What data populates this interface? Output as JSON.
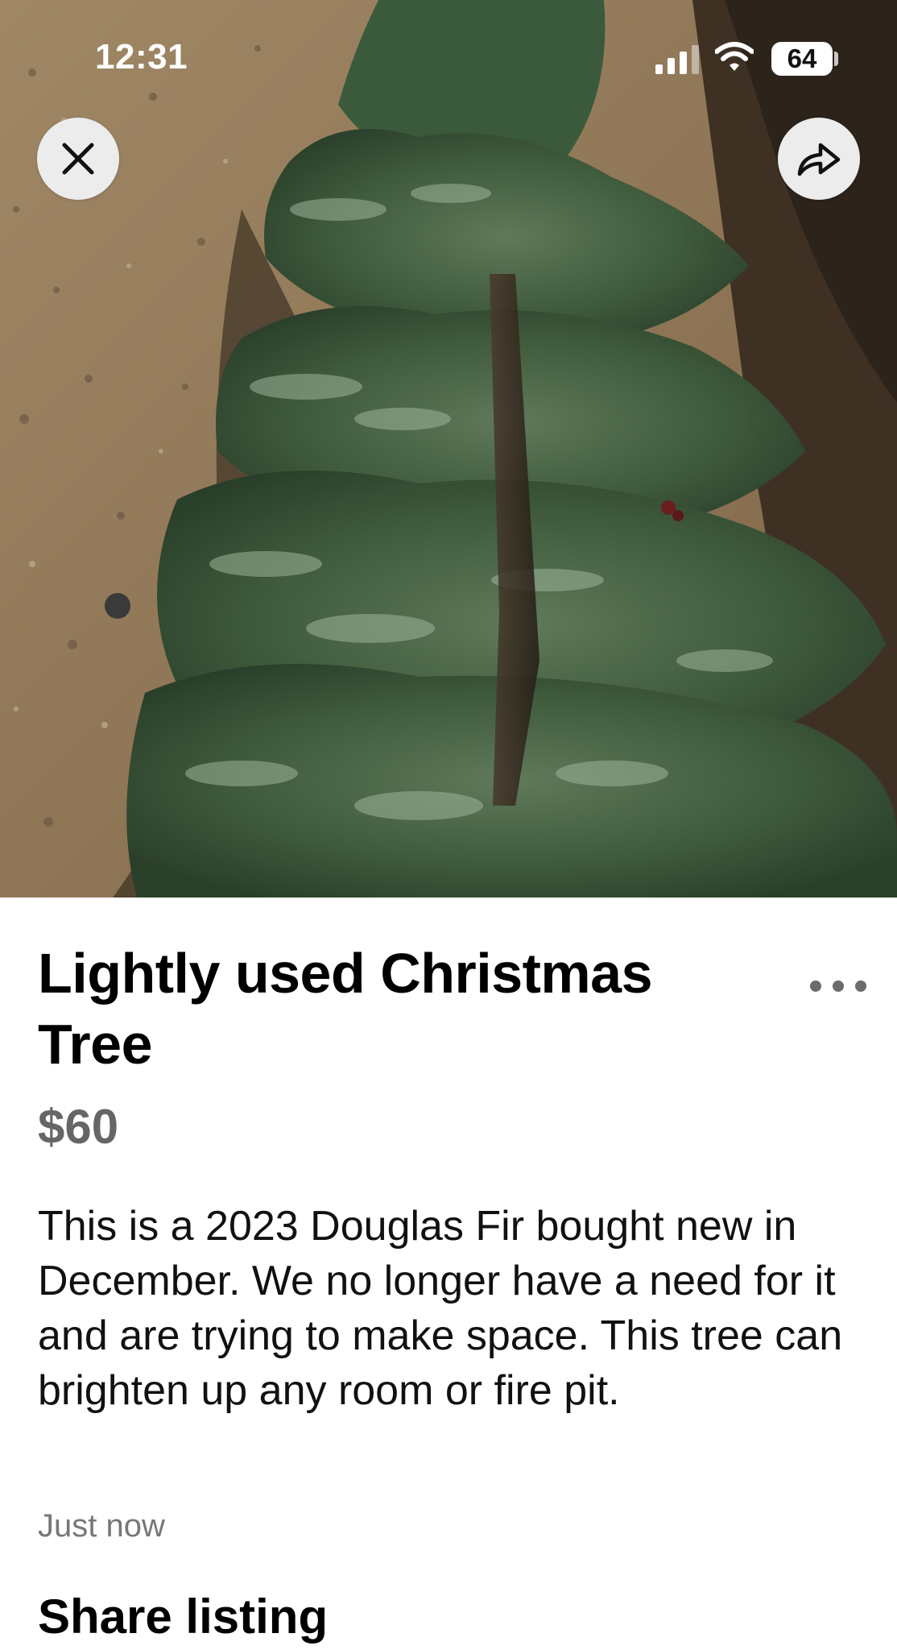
{
  "status_bar": {
    "time": "12:31",
    "battery": "64",
    "signal_icon": "cellular-signal-icon",
    "wifi_icon": "wifi-icon"
  },
  "photo": {
    "subject": "christmas-tree-photo"
  },
  "toolbar": {
    "close_icon": "close-icon",
    "share_icon": "share-arrow-icon",
    "more_icon": "more-dots-icon"
  },
  "listing": {
    "title": "Lightly used Christmas Tree",
    "price": "$60",
    "description": "This is a 2023 Douglas Fir bought new in December. We no longer have a need for it and are trying to make space. This tree can brighten up any room or fire pit.",
    "posted": "Just now"
  },
  "sections": {
    "share_heading": "Share listing"
  },
  "colors": {
    "title": "#000000",
    "price": "#666666",
    "muted": "#777777",
    "button_bg": "#ececec"
  }
}
